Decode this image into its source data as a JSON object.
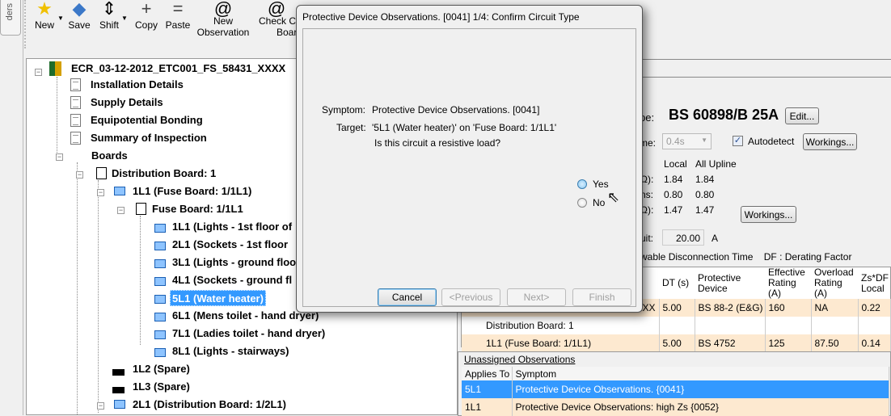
{
  "side_tab": "ders",
  "toolbar": {
    "new": "New",
    "save": "Save",
    "shift": "Shift",
    "copy": "Copy",
    "paste": "Paste",
    "new_obs_1": "New",
    "new_obs_2": "Observation",
    "check_1": "Check C",
    "check_2": "Boar"
  },
  "tree": {
    "root": "ECR_03-12-2012_ETC001_FS_58431_XXXX",
    "installation": "Installation Details",
    "supply": "Supply Details",
    "equipotential": "Equipotential Bonding",
    "summary": "Summary of Inspection",
    "boards": "Boards",
    "db1": "Distribution Board: 1",
    "c1l1": "1L1 (Fuse Board: 1/1L1)",
    "fb": "Fuse Board: 1/1L1",
    "circuits": [
      "1L1 (Lights - 1st floor of",
      "2L1 (Sockets - 1st floor",
      "3L1 (Lights - ground floo",
      "4L1 (Sockets - ground fl",
      "5L1 (Water heater)",
      "6L1 (Mens toilet - hand dryer)",
      "7L1 (Ladies toilet - hand dryer)",
      "8L1 (Lights - stairways)"
    ],
    "spare1": "1L2 (Spare)",
    "spare2": "1L3 (Spare)",
    "db2": "2L1 (Distribution Board: 1/2L1)"
  },
  "props": {
    "type_label": "pe:",
    "type_value": "BS 60898/B 25A",
    "edit": "Edit...",
    "time_label": "me:",
    "time_value": "0.4s",
    "autodetect": "Autodetect",
    "autodetect_checked": true,
    "workings": "Workings...",
    "col_local": "Local",
    "col_upline": "All Upline",
    "r1_label": "Ω):",
    "r1_local": "1.84",
    "r1_up": "1.84",
    "r2_label": "ns:",
    "r2_local": "0.80",
    "r2_up": "0.80",
    "r3_label": "Ω):",
    "r3_local": "1.47",
    "r3_up": "1.47",
    "workings2": "Workings...",
    "limit_label": "uit:",
    "limit_value": "20.00",
    "limit_unit": "A",
    "legend": "wable Disconnection Time    DF : Derating Factor"
  },
  "grid": {
    "headers": [
      "",
      "DT (s)",
      "Protective Device",
      "Effective Rating (A)",
      "Overload Rating (A)",
      "Zs*DF Local"
    ],
    "rows": [
      [
        "XXXXXX",
        "5.00",
        "BS 88-2 (E&G)",
        "160",
        "NA",
        "0.22"
      ],
      [
        "Distribution Board: 1",
        "",
        "",
        "",
        "",
        ""
      ],
      [
        "1L1 (Fuse Board: 1/1L1)",
        "5.00",
        "BS 4752",
        "125",
        "87.50",
        "0.14"
      ]
    ]
  },
  "unassigned": {
    "title": "Unassigned Observations",
    "headers": [
      "Applies To",
      "Symptom"
    ],
    "rows": [
      [
        "5L1",
        "Protective Device Observations. {0041}"
      ],
      [
        "1L1",
        "Protective Device Observations: high Zs {0052}"
      ]
    ]
  },
  "dialog": {
    "title": "Protective Device Observations. [0041] 1/4: Confirm Circuit Type",
    "symptom_label": "Symptom:",
    "symptom": "Protective Device Observations. [0041]",
    "target_label": "Target:",
    "target": "'5L1 (Water heater)' on 'Fuse Board: 1/1L1'",
    "question": "Is this circuit a resistive load?",
    "yes": "Yes",
    "no": "No",
    "cancel": "Cancel",
    "previous": "<Previous",
    "next": "Next>",
    "finish": "Finish"
  },
  "colors": {
    "selection": "#3399ff",
    "row_highlight": "#fde9d0"
  }
}
